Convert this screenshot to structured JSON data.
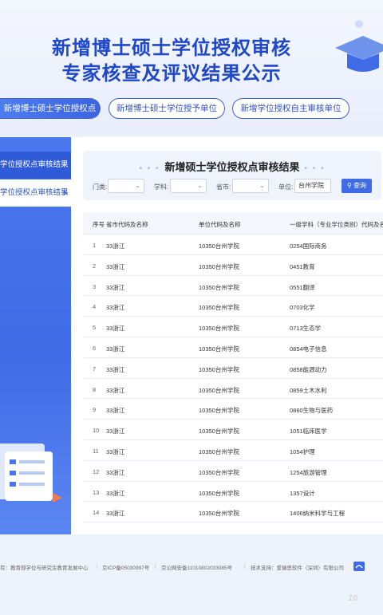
{
  "header": {
    "title_line1": "新增博士硕士学位授权审核",
    "title_line2": "专家核查及评议结果公示"
  },
  "tabs": [
    {
      "label": "新增博士硕士学位授权点",
      "active": true
    },
    {
      "label": "新增博士硕士学位授予单位",
      "active": false
    },
    {
      "label": "新增学位授权自主审核单位",
      "active": false
    }
  ],
  "sidebar": {
    "items": [
      {
        "label": "学位授权点审核结果",
        "active": false
      },
      {
        "label": "学位授权点审核结果",
        "active": true,
        "chevron": ">"
      }
    ]
  },
  "results": {
    "title": "新增硕士学位授权点审核结果",
    "filters": {
      "category_label": "门类:",
      "discipline_label": "学科:",
      "province_label": "省市:",
      "unit_label": "单位:",
      "unit_value": "台州学院",
      "query_button": "查询"
    },
    "columns": [
      "序号",
      "省市代码及名称",
      "单位代码及名称",
      "一级学科（专业学位类别）代码及名称"
    ],
    "rows": [
      {
        "no": "1",
        "province": "33浙江",
        "unit": "10350台州学院",
        "subject": "0254国际商务"
      },
      {
        "no": "2",
        "province": "33浙江",
        "unit": "10350台州学院",
        "subject": "0451教育"
      },
      {
        "no": "3",
        "province": "33浙江",
        "unit": "10350台州学院",
        "subject": "0551翻译"
      },
      {
        "no": "4",
        "province": "33浙江",
        "unit": "10350台州学院",
        "subject": "0703化学"
      },
      {
        "no": "5",
        "province": "33浙江",
        "unit": "10350台州学院",
        "subject": "0713生态学"
      },
      {
        "no": "6",
        "province": "33浙江",
        "unit": "10350台州学院",
        "subject": "0854电子信息"
      },
      {
        "no": "7",
        "province": "33浙江",
        "unit": "10350台州学院",
        "subject": "0858能源动力"
      },
      {
        "no": "8",
        "province": "33浙江",
        "unit": "10350台州学院",
        "subject": "0859土木水利"
      },
      {
        "no": "9",
        "province": "33浙江",
        "unit": "10350台州学院",
        "subject": "0860生物与医药"
      },
      {
        "no": "10",
        "province": "33浙江",
        "unit": "10350台州学院",
        "subject": "1051临床医学"
      },
      {
        "no": "11",
        "province": "33浙江",
        "unit": "10350台州学院",
        "subject": "1054护理"
      },
      {
        "no": "12",
        "province": "33浙江",
        "unit": "10350台州学院",
        "subject": "1254旅游管理"
      },
      {
        "no": "13",
        "province": "33浙江",
        "unit": "10350台州学院",
        "subject": "1357设计"
      },
      {
        "no": "14",
        "province": "33浙江",
        "unit": "10350台州学院",
        "subject": "1406纳米科学与工程"
      }
    ]
  },
  "footer": {
    "owner": "有：教育部学位与研究生教育发展中心",
    "icp": "京ICP备05030997号",
    "police": "京公网安备11010802033085号",
    "support": "技术支持：爱瑞思软件（深圳）有限公司"
  },
  "watermark": "10"
}
